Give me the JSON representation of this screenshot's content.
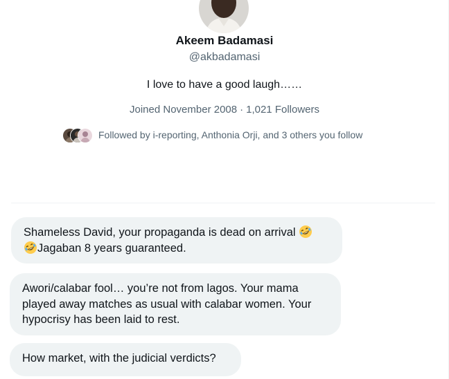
{
  "profile": {
    "name": "Akeem Badamasi",
    "handle": "@akbadamasi",
    "bio": "I love to have a good laugh……",
    "joined": "Joined November 2008",
    "separator": "·",
    "followers": "1,021 Followers",
    "followed_by": "Followed by i-reporting, Anthonia Orji, and 3 others you follow",
    "avatar_icon": "user-avatar"
  },
  "messages": [
    {
      "line1": "Shameless David, your propaganda is dead on arrival ",
      "line2": "Jagaban 8 years guaranteed.",
      "emoji": "rolling-on-floor-laughing-emoji"
    },
    {
      "text": "Awori/calabar fool… you’re not from lagos. Your mama played away matches as usual with calabar women. Your hypocrisy has been laid to rest."
    },
    {
      "text": "How market, with the judicial verdicts?"
    }
  ],
  "colors": {
    "bubble_bg": "#eff3f4",
    "secondary_text": "#536471",
    "primary_text": "#0f1419"
  }
}
